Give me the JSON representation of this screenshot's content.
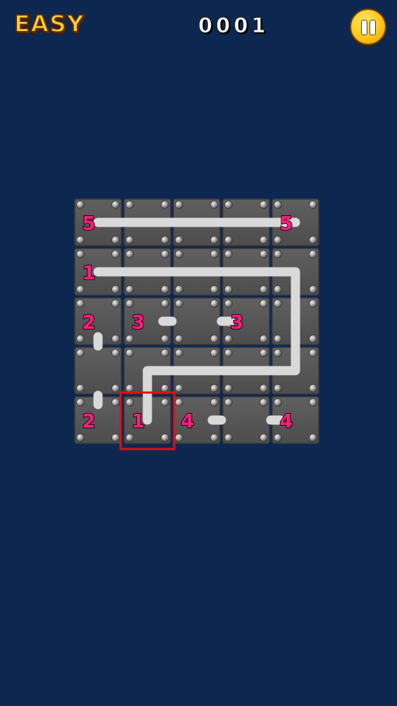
{
  "header": {
    "difficulty": "EASY",
    "score": "0001",
    "pause_icon": "pause-icon"
  },
  "colors": {
    "background": "#0e2750",
    "tile": "#555555",
    "path": "#d9d9d9",
    "number": "#ff1f7e",
    "selection": "#e01010",
    "accent": "#ffcf2e"
  },
  "grid": {
    "rows": 5,
    "cols": 5,
    "numbers": [
      {
        "row": 0,
        "col": 0,
        "value": "5"
      },
      {
        "row": 0,
        "col": 4,
        "value": "5"
      },
      {
        "row": 1,
        "col": 0,
        "value": "1"
      },
      {
        "row": 2,
        "col": 0,
        "value": "2"
      },
      {
        "row": 2,
        "col": 1,
        "value": "3"
      },
      {
        "row": 2,
        "col": 3,
        "value": "3"
      },
      {
        "row": 4,
        "col": 0,
        "value": "2"
      },
      {
        "row": 4,
        "col": 1,
        "value": "1"
      },
      {
        "row": 4,
        "col": 2,
        "value": "4"
      },
      {
        "row": 4,
        "col": 4,
        "value": "4"
      }
    ],
    "paths": [
      {
        "color": "path",
        "cells": [
          [
            0,
            0
          ],
          [
            0,
            1
          ],
          [
            0,
            2
          ],
          [
            0,
            3
          ],
          [
            0,
            4
          ]
        ]
      },
      {
        "color": "path",
        "cells": [
          [
            1,
            0
          ],
          [
            1,
            1
          ],
          [
            1,
            2
          ],
          [
            1,
            3
          ],
          [
            1,
            4
          ],
          [
            2,
            4
          ],
          [
            3,
            4
          ],
          [
            3,
            3
          ],
          [
            3,
            2
          ],
          [
            3,
            1
          ],
          [
            4,
            1
          ]
        ]
      }
    ],
    "stubs": [
      {
        "row": 2,
        "col": 1,
        "dir": "right"
      },
      {
        "row": 2,
        "col": 3,
        "dir": "left"
      },
      {
        "row": 2,
        "col": 0,
        "dir": "down"
      },
      {
        "row": 4,
        "col": 0,
        "dir": "up"
      },
      {
        "row": 4,
        "col": 2,
        "dir": "right"
      },
      {
        "row": 4,
        "col": 4,
        "dir": "left"
      }
    ],
    "selected": {
      "row": 4,
      "col": 1
    }
  }
}
